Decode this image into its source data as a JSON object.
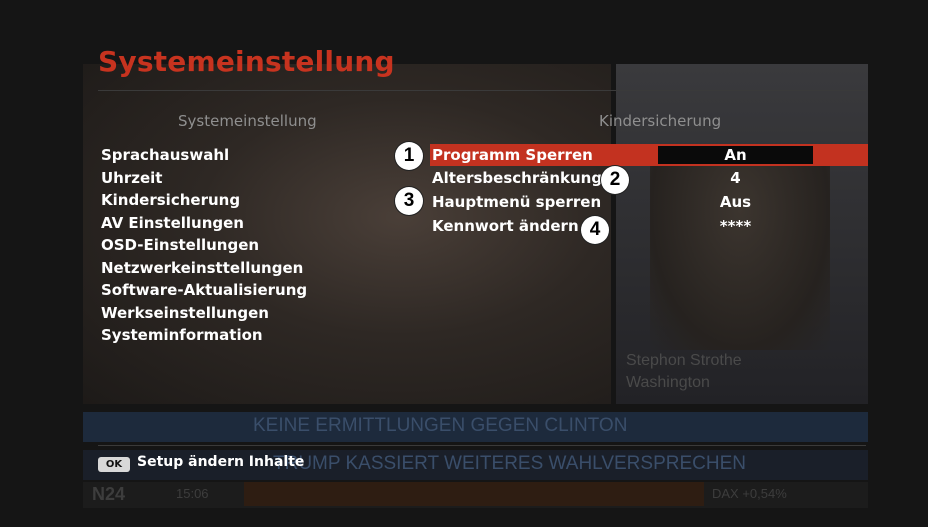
{
  "background": {
    "caption_line1": "Stephon Strothe",
    "caption_line2": "Washington",
    "ticker_top": "KEINE ERMITTLUNGEN GEGEN CLINTON",
    "ticker_bottom": "TRUMP KASSIERT WEITERES WAHLVERSPRECHEN",
    "channel": "N24",
    "time": "15:06",
    "index": "DAX +0,54%"
  },
  "title": "Systemeinstellung",
  "left_header": "Systemeinstellung",
  "right_header": "Kindersicherung",
  "menu": [
    "Sprachauswahl",
    "Uhrzeit",
    "Kindersicherung",
    "AV Einstellungen",
    "OSD-Einstellungen",
    "Netzwerkeinsttellungen",
    "Software-Aktualisierung",
    "Werkseinstellungen",
    "Systeminformation"
  ],
  "settings": [
    {
      "label": "Programm Sperren",
      "value": "An",
      "badge": "1"
    },
    {
      "label": "Altersbeschränkung",
      "value": "4",
      "badge": "2"
    },
    {
      "label": "Hauptmenü sperren",
      "value": "Aus",
      "badge": "3"
    },
    {
      "label": "Kennwort ändern",
      "value": "****",
      "badge": "4"
    }
  ],
  "help": {
    "key": "OK",
    "text": "Setup ändern Inhalte"
  },
  "colors": {
    "accent": "#c33220",
    "title": "#c7331f"
  }
}
